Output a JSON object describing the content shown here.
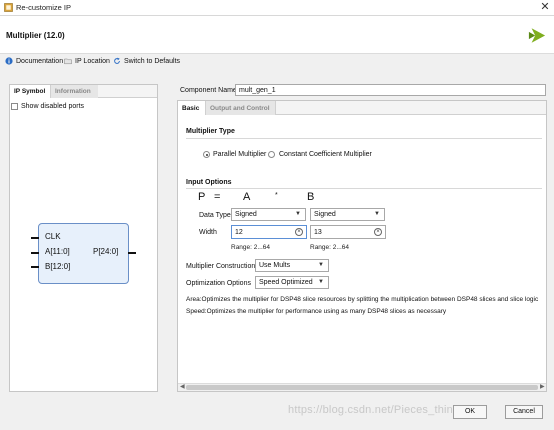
{
  "window": {
    "title": "Re-customize IP"
  },
  "header": {
    "ip_title": "Multiplier (12.0)"
  },
  "toolbar": {
    "documentation": "Documentation",
    "ip_location": "IP Location",
    "switch_defaults": "Switch to Defaults"
  },
  "left": {
    "tabs": [
      "IP Symbol",
      "Information"
    ],
    "show_disabled_ports": "Show disabled ports",
    "symbol": {
      "clk": "CLK",
      "a": "A[11:0]",
      "b": "B[12:0]",
      "p": "P[24:0]"
    }
  },
  "right": {
    "component_name_label": "Component Name",
    "component_name_value": "mult_gen_1",
    "tabs": [
      "Basic",
      "Output and Control"
    ],
    "multiplier_type": {
      "title": "Multiplier Type",
      "options": [
        "Parallel Multiplier",
        "Constant Coefficient Multiplier"
      ],
      "selected": "Parallel Multiplier"
    },
    "input_options": {
      "title": "Input Options",
      "eq_p": "P",
      "eq_equals": "=",
      "eq_a": "A",
      "eq_times": "*",
      "eq_b": "B",
      "data_type_label": "Data Type",
      "data_type_a": "Signed",
      "data_type_b": "Signed",
      "width_label": "Width",
      "width_a": "12",
      "width_b": "13",
      "range_a": "Range: 2...64",
      "range_b": "Range: 2...64"
    },
    "multiplier_construction_label": "Multiplier Construction",
    "multiplier_construction_value": "Use Mults",
    "optimization_label": "Optimization Options",
    "optimization_value": "Speed Optimized",
    "desc_area": "Area:Optimizes the multiplier for DSP48 slice resources by splitting the multiplication between DSP48 slices and slice logic",
    "desc_speed": "Speed:Optimizes the multiplier for performance using as many DSP48 slices as necessary"
  },
  "footer": {
    "ok": "OK",
    "cancel": "Cancel",
    "watermark": "https://blog.csdn.net/Pieces_thinking"
  },
  "colors": {
    "logo_green": "#7fae1f",
    "symbol_fill": "#e7f0fb",
    "symbol_border": "#6a8fc7",
    "info_icon": "#2b6cc4",
    "refresh_icon": "#2b6cc4"
  }
}
